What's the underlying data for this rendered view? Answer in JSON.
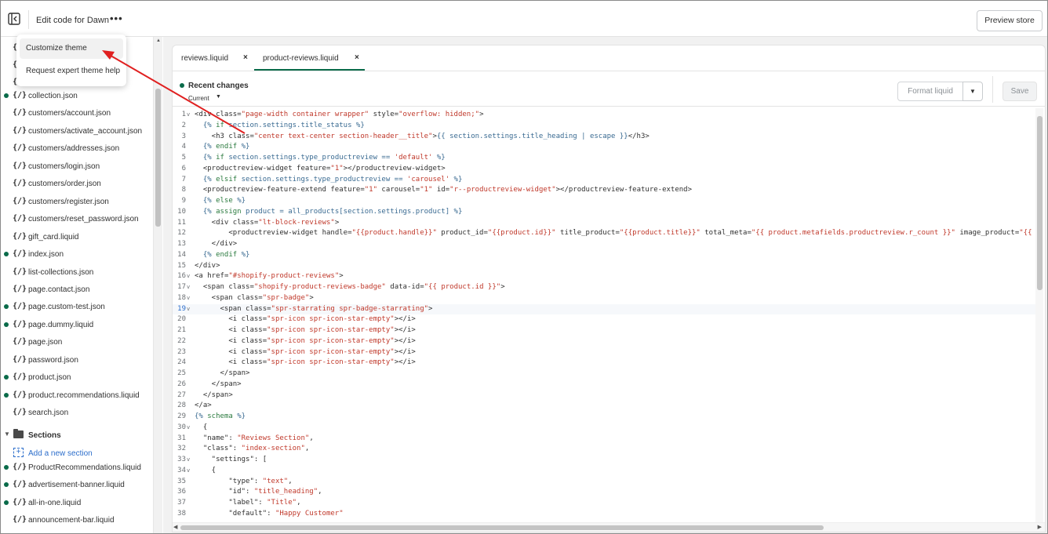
{
  "header": {
    "title": "Edit code for Dawn",
    "more_label": "•••",
    "preview_label": "Preview store"
  },
  "popover": {
    "items": [
      "Customize theme",
      "Request expert theme help"
    ]
  },
  "sidebar": {
    "top_partial": [
      "{.",
      "{.",
      "{."
    ],
    "files": [
      {
        "name": "collection.json",
        "changed": true
      },
      {
        "name": "customers/account.json",
        "changed": false
      },
      {
        "name": "customers/activate_account.json",
        "changed": false
      },
      {
        "name": "customers/addresses.json",
        "changed": false
      },
      {
        "name": "customers/login.json",
        "changed": false
      },
      {
        "name": "customers/order.json",
        "changed": false
      },
      {
        "name": "customers/register.json",
        "changed": false
      },
      {
        "name": "customers/reset_password.json",
        "changed": false
      },
      {
        "name": "gift_card.liquid",
        "changed": false
      },
      {
        "name": "index.json",
        "changed": true
      },
      {
        "name": "list-collections.json",
        "changed": false
      },
      {
        "name": "page.contact.json",
        "changed": false
      },
      {
        "name": "page.custom-test.json",
        "changed": true
      },
      {
        "name": "page.dummy.liquid",
        "changed": true
      },
      {
        "name": "page.json",
        "changed": false
      },
      {
        "name": "password.json",
        "changed": false
      },
      {
        "name": "product.json",
        "changed": true
      },
      {
        "name": "product.recommendations.liquid",
        "changed": true
      },
      {
        "name": "search.json",
        "changed": false
      }
    ],
    "sections_label": "Sections",
    "add_section_label": "Add a new section",
    "section_files": [
      {
        "name": "ProductRecommendations.liquid",
        "changed": true
      },
      {
        "name": "advertisement-banner.liquid",
        "changed": true
      },
      {
        "name": "all-in-one.liquid",
        "changed": true
      },
      {
        "name": "announcement-bar.liquid",
        "changed": false
      }
    ],
    "file_icon": "{/}"
  },
  "tabs": [
    {
      "label": "reviews.liquid",
      "close": "×"
    },
    {
      "label": "product-reviews.liquid",
      "close": "×"
    }
  ],
  "toolbar": {
    "recent_changes": "Recent changes",
    "version": "Current",
    "format_label": "Format liquid",
    "save_label": "Save"
  },
  "code": {
    "current_line": 19,
    "lines": [
      {
        "n": "1",
        "fold": true,
        "t": [
          [
            "tag",
            "<div "
          ],
          [
            "attr",
            "class="
          ],
          [
            "str",
            "\"page-width container wrapper\""
          ],
          [
            "attr",
            " style="
          ],
          [
            "str",
            "\"overflow: hidden;\""
          ],
          [
            "tag",
            ">"
          ]
        ]
      },
      {
        "n": "2",
        "t": [
          [
            "liq",
            "  {% "
          ],
          [
            "kw",
            "if"
          ],
          [
            "liq",
            " section.settings.title_status %}"
          ]
        ]
      },
      {
        "n": "3",
        "t": [
          [
            "tag",
            "    <h3 "
          ],
          [
            "attr",
            "class="
          ],
          [
            "str",
            "\"center text-center section-header__title\""
          ],
          [
            "tag",
            ">"
          ],
          [
            "liq",
            "{{ section.settings.title_heading | escape }}"
          ],
          [
            "tag",
            "</h3>"
          ]
        ]
      },
      {
        "n": "4",
        "t": [
          [
            "liq",
            "  {% "
          ],
          [
            "kw",
            "endif"
          ],
          [
            "liq",
            " %}"
          ]
        ]
      },
      {
        "n": "5",
        "t": [
          [
            "liq",
            "  {% "
          ],
          [
            "kw",
            "if"
          ],
          [
            "liq",
            " section.settings.type_productreview == "
          ],
          [
            "str",
            "'default'"
          ],
          [
            "liq",
            " %}"
          ]
        ]
      },
      {
        "n": "6",
        "t": [
          [
            "tag",
            "  <productreview-widget "
          ],
          [
            "attr",
            "feature="
          ],
          [
            "str",
            "\"1\""
          ],
          [
            "tag",
            "></productreview-widget>"
          ]
        ]
      },
      {
        "n": "7",
        "t": [
          [
            "liq",
            "  {% "
          ],
          [
            "kw",
            "elsif"
          ],
          [
            "liq",
            " section.settings.type_productreview == "
          ],
          [
            "str",
            "'carousel'"
          ],
          [
            "liq",
            " %}"
          ]
        ]
      },
      {
        "n": "8",
        "t": [
          [
            "tag",
            "  <productreview-feature-extend "
          ],
          [
            "attr",
            "feature="
          ],
          [
            "str",
            "\"1\""
          ],
          [
            "attr",
            " carousel="
          ],
          [
            "str",
            "\"1\""
          ],
          [
            "attr",
            " id="
          ],
          [
            "str",
            "\"r--productreview-widget\""
          ],
          [
            "tag",
            "></productreview-feature-extend>"
          ]
        ]
      },
      {
        "n": "9",
        "t": [
          [
            "liq",
            "  {% "
          ],
          [
            "kw",
            "else"
          ],
          [
            "liq",
            " %}"
          ]
        ]
      },
      {
        "n": "10",
        "t": [
          [
            "liq",
            "  {% "
          ],
          [
            "kw",
            "assign"
          ],
          [
            "liq",
            " product = all_products[section.settings.product] %}"
          ]
        ]
      },
      {
        "n": "11",
        "t": [
          [
            "tag",
            "    <div "
          ],
          [
            "attr",
            "class="
          ],
          [
            "str",
            "\"lt-block-reviews\""
          ],
          [
            "tag",
            ">"
          ]
        ]
      },
      {
        "n": "12",
        "t": [
          [
            "tag",
            "        <productreview-widget "
          ],
          [
            "attr",
            "handle="
          ],
          [
            "str",
            "\"{{product.handle}}\""
          ],
          [
            "attr",
            " product_id="
          ],
          [
            "str",
            "\"{{product.id}}\""
          ],
          [
            "attr",
            " title_product="
          ],
          [
            "str",
            "\"{{product.title}}\""
          ],
          [
            "attr",
            " total_meta="
          ],
          [
            "str",
            "\"{{ product.metafields.productreview.r_count }}\""
          ],
          [
            "attr",
            " image_product="
          ],
          [
            "str",
            "\"{{ p"
          ]
        ]
      },
      {
        "n": "13",
        "t": [
          [
            "tag",
            "    </div>"
          ]
        ]
      },
      {
        "n": "14",
        "t": [
          [
            "liq",
            "  {% "
          ],
          [
            "kw",
            "endif"
          ],
          [
            "liq",
            " %}"
          ]
        ]
      },
      {
        "n": "15",
        "t": [
          [
            "tag",
            "</div>"
          ]
        ]
      },
      {
        "n": "16",
        "fold": true,
        "t": [
          [
            "tag",
            "<a "
          ],
          [
            "attr",
            "href="
          ],
          [
            "str",
            "\"#shopify-product-reviews\""
          ],
          [
            "tag",
            ">"
          ]
        ]
      },
      {
        "n": "17",
        "fold": true,
        "t": [
          [
            "tag",
            "  <span "
          ],
          [
            "attr",
            "class="
          ],
          [
            "str",
            "\"shopify-product-reviews-badge\""
          ],
          [
            "attr",
            " data-id="
          ],
          [
            "str",
            "\"{{ product.id }}\""
          ],
          [
            "tag",
            ">"
          ]
        ]
      },
      {
        "n": "18",
        "fold": true,
        "t": [
          [
            "tag",
            "    <span "
          ],
          [
            "attr",
            "class="
          ],
          [
            "str",
            "\"spr-badge\""
          ],
          [
            "tag",
            ">"
          ]
        ]
      },
      {
        "n": "19",
        "fold": true,
        "t": [
          [
            "tag",
            "      <span "
          ],
          [
            "attr",
            "class="
          ],
          [
            "str",
            "\"spr-starrating spr-badge-starrating\""
          ],
          [
            "tag",
            ">"
          ]
        ]
      },
      {
        "n": "20",
        "t": [
          [
            "tag",
            "        <i "
          ],
          [
            "attr",
            "class="
          ],
          [
            "str",
            "\"spr-icon spr-icon-star-empty\""
          ],
          [
            "tag",
            "></i>"
          ]
        ]
      },
      {
        "n": "21",
        "t": [
          [
            "tag",
            "        <i "
          ],
          [
            "attr",
            "class="
          ],
          [
            "str",
            "\"spr-icon spr-icon-star-empty\""
          ],
          [
            "tag",
            "></i>"
          ]
        ]
      },
      {
        "n": "22",
        "t": [
          [
            "tag",
            "        <i "
          ],
          [
            "attr",
            "class="
          ],
          [
            "str",
            "\"spr-icon spr-icon-star-empty\""
          ],
          [
            "tag",
            "></i>"
          ]
        ]
      },
      {
        "n": "23",
        "t": [
          [
            "tag",
            "        <i "
          ],
          [
            "attr",
            "class="
          ],
          [
            "str",
            "\"spr-icon spr-icon-star-empty\""
          ],
          [
            "tag",
            "></i>"
          ]
        ]
      },
      {
        "n": "24",
        "t": [
          [
            "tag",
            "        <i "
          ],
          [
            "attr",
            "class="
          ],
          [
            "str",
            "\"spr-icon spr-icon-star-empty\""
          ],
          [
            "tag",
            "></i>"
          ]
        ]
      },
      {
        "n": "25",
        "t": [
          [
            "tag",
            "      </span>"
          ]
        ]
      },
      {
        "n": "26",
        "t": [
          [
            "tag",
            "    </span>"
          ]
        ]
      },
      {
        "n": "27",
        "t": [
          [
            "tag",
            "  </span>"
          ]
        ]
      },
      {
        "n": "28",
        "t": [
          [
            "tag",
            "</a>"
          ]
        ]
      },
      {
        "n": "29",
        "t": [
          [
            "liq",
            "{% "
          ],
          [
            "kw",
            "schema"
          ],
          [
            "liq",
            " %}"
          ]
        ]
      },
      {
        "n": "30",
        "fold": true,
        "t": [
          [
            "key",
            "  {"
          ]
        ]
      },
      {
        "n": "31",
        "t": [
          [
            "key",
            "  \"name\": "
          ],
          [
            "str",
            "\"Reviews Section\""
          ],
          [
            "key",
            ","
          ]
        ]
      },
      {
        "n": "32",
        "t": [
          [
            "key",
            "  \"class\": "
          ],
          [
            "str",
            "\"index-section\""
          ],
          [
            "key",
            ","
          ]
        ]
      },
      {
        "n": "33",
        "fold": true,
        "t": [
          [
            "key",
            "    \"settings\": ["
          ]
        ]
      },
      {
        "n": "34",
        "fold": true,
        "t": [
          [
            "key",
            "    {"
          ]
        ]
      },
      {
        "n": "35",
        "t": [
          [
            "key",
            "        \"type\": "
          ],
          [
            "str",
            "\"text\""
          ],
          [
            "key",
            ","
          ]
        ]
      },
      {
        "n": "36",
        "t": [
          [
            "key",
            "        \"id\": "
          ],
          [
            "str",
            "\"title_heading\""
          ],
          [
            "key",
            ","
          ]
        ]
      },
      {
        "n": "37",
        "t": [
          [
            "key",
            "        \"label\": "
          ],
          [
            "str",
            "\"Title\""
          ],
          [
            "key",
            ","
          ]
        ]
      },
      {
        "n": "38",
        "t": [
          [
            "key",
            "        \"default\": "
          ],
          [
            "str",
            "\"Happy Customer\""
          ]
        ]
      }
    ]
  },
  "colors": {
    "accent": "#0a6b4a",
    "link": "#2c6ecb",
    "annotation_arrow": "#e02020"
  },
  "icons": {
    "exit": "exit-icon",
    "scroll_up": "▲",
    "scroll_left": "◀",
    "scroll_right": "▶",
    "caret_down": "▼",
    "folder": "folder-icon",
    "add_file": "add-file-icon"
  }
}
